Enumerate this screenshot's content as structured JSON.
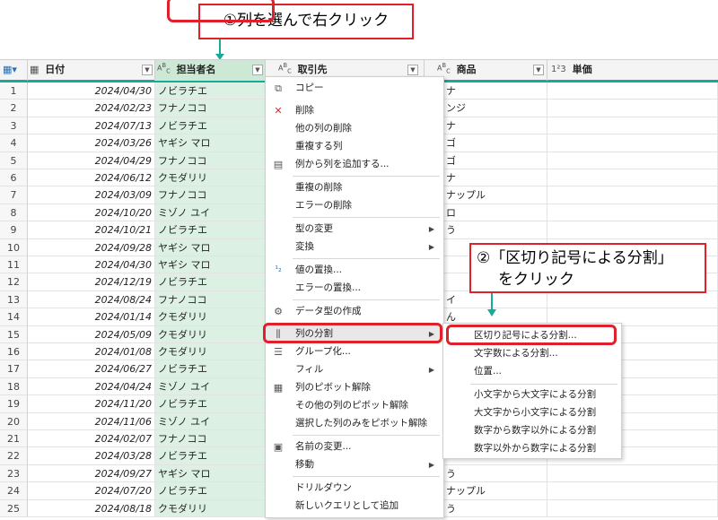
{
  "callouts": {
    "step1": "①列を選んで右クリック",
    "step2_line1": "②「区切り記号による分割」",
    "step2_line2": "をクリック"
  },
  "header": {
    "date": "日付",
    "person": "担当者名",
    "client": "取引先",
    "product": "商品",
    "price": "単価",
    "type_date": "▦",
    "type_text": "Aᴮᶜ",
    "type_num": "1²3"
  },
  "rows": [
    {
      "n": "1",
      "date": "2024/04/30",
      "person": "ノビラチエ",
      "client": "",
      "product": "ナ"
    },
    {
      "n": "2",
      "date": "2024/02/23",
      "person": "フナノココ",
      "client": "",
      "product": "ンジ"
    },
    {
      "n": "3",
      "date": "2024/07/13",
      "person": "ノビラチエ",
      "client": "",
      "product": "ナ"
    },
    {
      "n": "4",
      "date": "2024/03/26",
      "person": "ヤギシ マロ",
      "client": "",
      "product": "ゴ"
    },
    {
      "n": "5",
      "date": "2024/04/29",
      "person": "フナノココ",
      "client": "",
      "product": "ゴ"
    },
    {
      "n": "6",
      "date": "2024/06/12",
      "person": "クモダリリ",
      "client": "",
      "product": "ナ"
    },
    {
      "n": "7",
      "date": "2024/03/09",
      "person": "フナノココ",
      "client": "",
      "product": "ナップル"
    },
    {
      "n": "8",
      "date": "2024/10/20",
      "person": "ミゾノ ユイ",
      "client": "",
      "product": "ロ"
    },
    {
      "n": "9",
      "date": "2024/10/21",
      "person": "ノビラチエ",
      "client": "",
      "product": "う"
    },
    {
      "n": "10",
      "date": "2024/09/28",
      "person": "ヤギシ マロ",
      "client": "",
      "product": ""
    },
    {
      "n": "11",
      "date": "2024/04/30",
      "person": "ヤギシ マロ",
      "client": "",
      "product": ""
    },
    {
      "n": "12",
      "date": "2024/12/19",
      "person": "ノビラチエ",
      "client": "",
      "product": ""
    },
    {
      "n": "13",
      "date": "2024/08/24",
      "person": "フナノココ",
      "client": "",
      "product": "イ"
    },
    {
      "n": "14",
      "date": "2024/01/14",
      "person": "クモダリリ",
      "client": "",
      "product": "ん"
    },
    {
      "n": "15",
      "date": "2024/05/09",
      "person": "クモダリリ",
      "client": "",
      "product": ""
    },
    {
      "n": "16",
      "date": "2024/01/08",
      "person": "クモダリリ",
      "client": "",
      "product": ""
    },
    {
      "n": "17",
      "date": "2024/06/27",
      "person": "ノビラチエ",
      "client": "",
      "product": ""
    },
    {
      "n": "18",
      "date": "2024/04/24",
      "person": "ミゾノ ユイ",
      "client": "",
      "product": ""
    },
    {
      "n": "19",
      "date": "2024/11/20",
      "person": "ノビラチエ",
      "client": "",
      "product": ""
    },
    {
      "n": "20",
      "date": "2024/11/06",
      "person": "ミゾノ ユイ",
      "client": "",
      "product": ""
    },
    {
      "n": "21",
      "date": "2024/02/07",
      "person": "フナノココ",
      "client": "",
      "product": ""
    },
    {
      "n": "22",
      "date": "2024/03/28",
      "person": "ノビラチエ",
      "client": "",
      "product": ""
    },
    {
      "n": "23",
      "date": "2024/09/27",
      "person": "ヤギシ マロ",
      "client": "",
      "product": "う"
    },
    {
      "n": "24",
      "date": "2024/07/20",
      "person": "ノビラチエ",
      "client": "",
      "product": "ナップル"
    },
    {
      "n": "25",
      "date": "2024/08/18",
      "person": "クモダリリ",
      "client": "",
      "product": "う"
    }
  ],
  "menu": {
    "copy": "コピー",
    "remove": "削除",
    "remove_other": "他の列の削除",
    "duplicate": "重複する列",
    "add_from_examples": "例から列を追加する...",
    "remove_duplicates": "重複の削除",
    "remove_errors": "エラーの削除",
    "change_type": "型の変更",
    "transform": "変換",
    "replace_values": "値の置換...",
    "replace_errors": "エラーの置換...",
    "create_data_type": "データ型の作成",
    "split_column": "列の分割",
    "group_by": "グループ化...",
    "fill": "フィル",
    "unpivot": "列のピボット解除",
    "unpivot_other": "その他の列のピボット解除",
    "unpivot_selected": "選択した列のみをピボット解除",
    "rename": "名前の変更...",
    "move": "移動",
    "drill_down": "ドリルダウン",
    "add_as_new_query": "新しいクエリとして追加"
  },
  "submenu": {
    "by_delimiter": "区切り記号による分割...",
    "by_chars": "文字数による分割...",
    "by_position": "位置...",
    "lower_to_upper": "小文字から大文字による分割",
    "upper_to_lower": "大文字から小文字による分割",
    "digit_to_nondigit": "数字から数字以外による分割",
    "nondigit_to_digit": "数字以外から数字による分割"
  }
}
